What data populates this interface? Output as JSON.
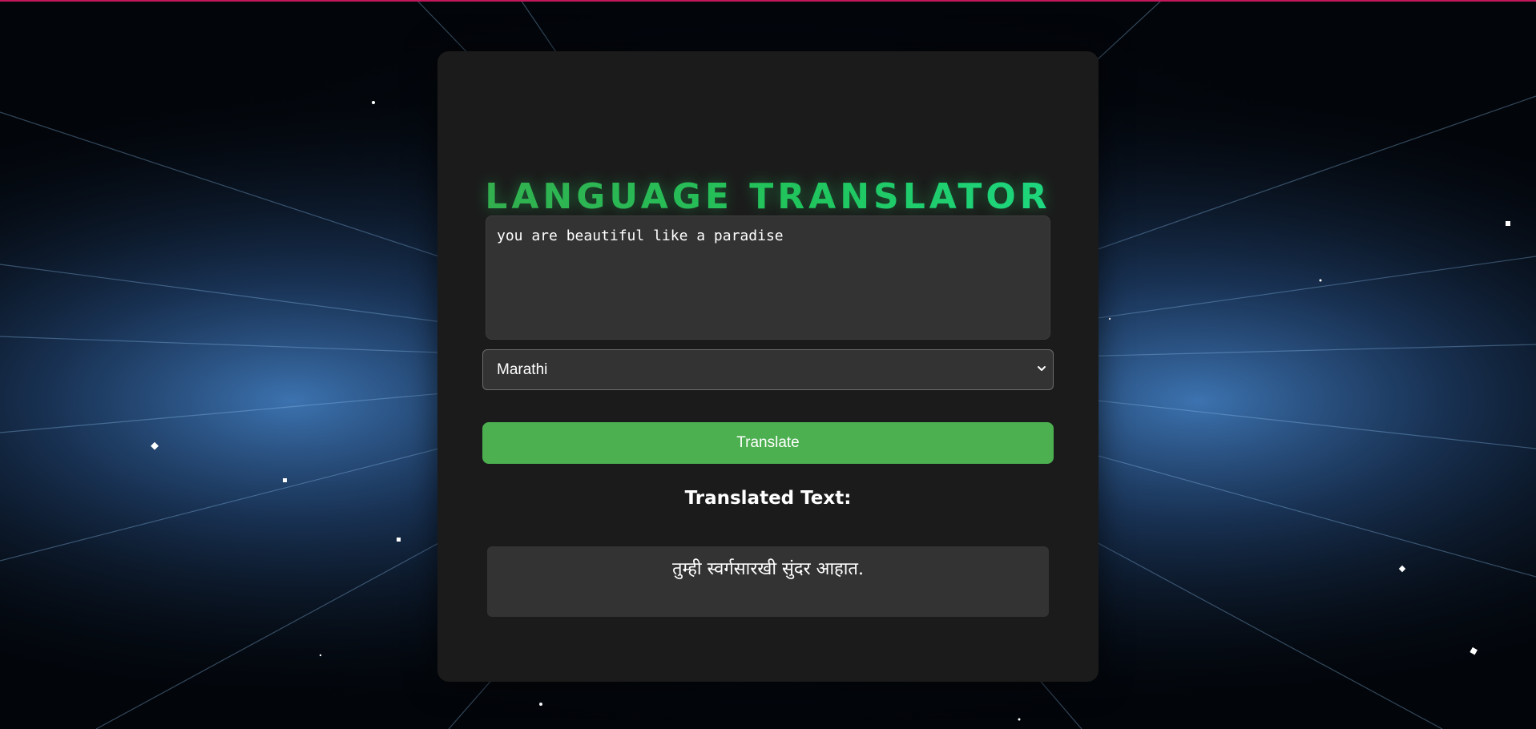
{
  "app": {
    "title": "LANGUAGE TRANSLATOR"
  },
  "input": {
    "value": "you are beautiful like a paradise"
  },
  "language_select": {
    "selected": "Marathi",
    "icon": "chevron-down-icon"
  },
  "actions": {
    "translate_label": "Translate"
  },
  "output": {
    "heading": "Translated Text:",
    "text": "तुम्ही स्वर्गसारखी सुंदर आहात."
  },
  "colors": {
    "accent": "#4caf50",
    "title_gradient_start": "#3aa84a",
    "title_gradient_end": "#1ee08f",
    "card_background": "#1b1b1b",
    "field_background": "#333333",
    "top_strip": "#c2185b"
  }
}
